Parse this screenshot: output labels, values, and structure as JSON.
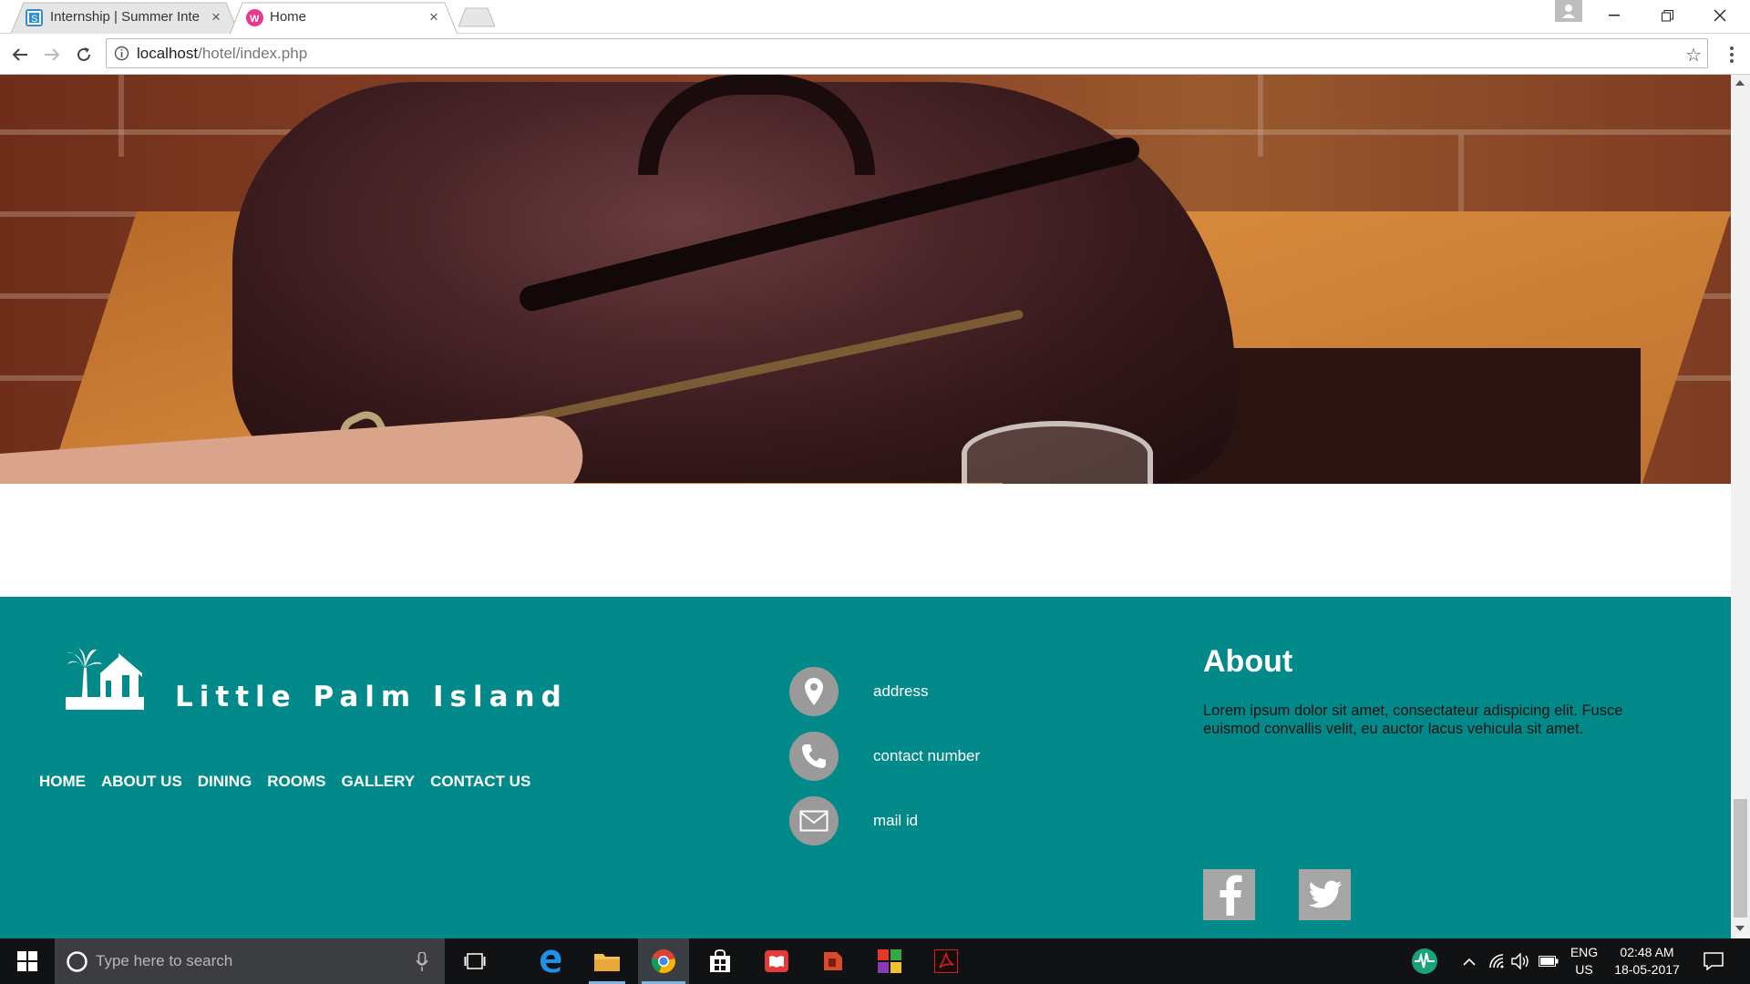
{
  "browser": {
    "tabs": [
      {
        "title": "Internship | Summer Inte",
        "active": false
      },
      {
        "title": "Home",
        "active": true
      }
    ],
    "url_host": "localhost",
    "url_path": "/hotel/index.php"
  },
  "site": {
    "brand": "Little Palm Island",
    "nav": [
      "HOME",
      "ABOUT US",
      "DINING",
      "ROOMS",
      "GALLERY",
      "CONTACT US"
    ],
    "contact": {
      "address": "address",
      "phone": "contact number",
      "email": "mail id"
    },
    "about": {
      "title": "About",
      "text": "Lorem ipsum dolor sit amet, consectateur adispicing elit. Fusce euismod convallis velit, eu auctor lacus vehicula sit amet."
    },
    "social": [
      "facebook-icon",
      "twitter-icon"
    ],
    "colors": {
      "footer_bg": "#028a8a",
      "icon_circle": "#9a9a9a",
      "social_bg": "#a6a6a6"
    }
  },
  "taskbar": {
    "search_placeholder": "Type here to search",
    "lang_line1": "ENG",
    "lang_line2": "US",
    "time": "02:48 AM",
    "date": "18-05-2017"
  }
}
